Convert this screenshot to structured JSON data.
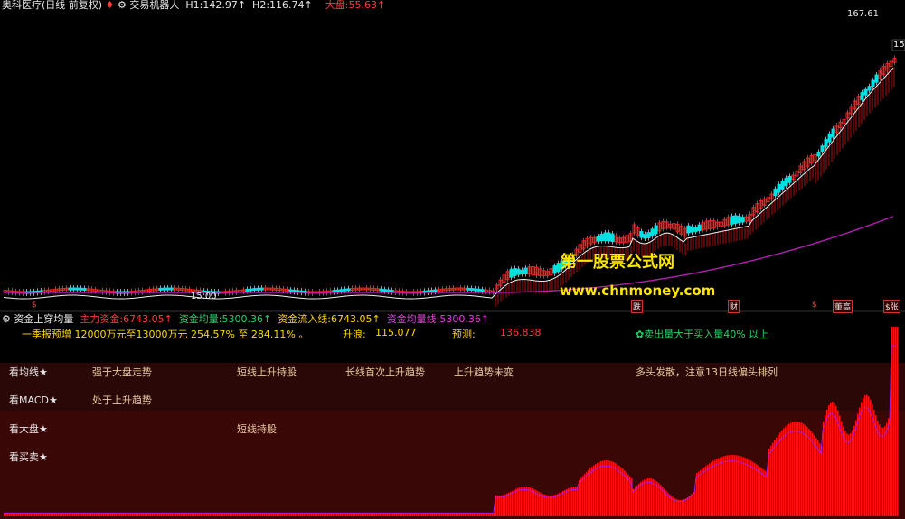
{
  "header": {
    "stock_name": "奥科医疗(日线 前复权)",
    "mark": "♦",
    "indicator": "交易机器人",
    "h1_label": "H1:",
    "h1_value": "142.97↑",
    "h2_label": "H2:",
    "h2_value": "116.74↑",
    "dapan_label": "大盘:",
    "dapan_value": "55.63↑"
  },
  "price_labels": {
    "high": "167.61",
    "right_cut": "15",
    "low": "15.00"
  },
  "watermark": {
    "line1": "第一股票公式网",
    "line2": "www.chnmoney.com"
  },
  "event_tags": [
    "$",
    "跌",
    "财",
    "$",
    "董高",
    "$张"
  ],
  "sub_header": {
    "title": "资金上穿均量",
    "zhuli_label": "主力资金:",
    "zhuli_value": "6743.05↑",
    "junliang_label": "资金均量:",
    "junliang_value": "5300.36↑",
    "liuru_label": "资金流入线:",
    "liuru_value": "6743.05↑",
    "junliangxian_label": "资金均量线:",
    "junliangxian_value": "5300.36↑"
  },
  "info_row": {
    "forecast": "一季报预增 12000万元至13000万元 254.57% 至 284.11% 。",
    "shenglang_label": "升浪:",
    "shenglang_value": "115.077",
    "yuce_label": "预测:",
    "yuce_value": "136.838",
    "note": "✿卖出量大于买入量40% 以上"
  },
  "panels": [
    {
      "label": "看均线★",
      "cells": [
        "强于大盘走势",
        "短线上升持股",
        "长线首次上升趋势",
        "上升趋势未变",
        "多头发散，注意13日线偏头排列"
      ]
    },
    {
      "label": "看MACD★",
      "cells": [
        "处于上升趋势"
      ]
    },
    {
      "label": "看大盘★",
      "cells": [
        "",
        "短线持股"
      ]
    },
    {
      "label": "看买卖★",
      "cells": []
    }
  ],
  "colors": {
    "background": "#000000",
    "up": "#ff2020",
    "down": "#00e0e0",
    "ma_white": "#f2f2f2",
    "ma_purple": "#b01fb0",
    "panel_band1": "#2a0808",
    "panel_band2": "#3a0707",
    "hist": "#ff1010",
    "watermark": "#ffe600"
  }
}
